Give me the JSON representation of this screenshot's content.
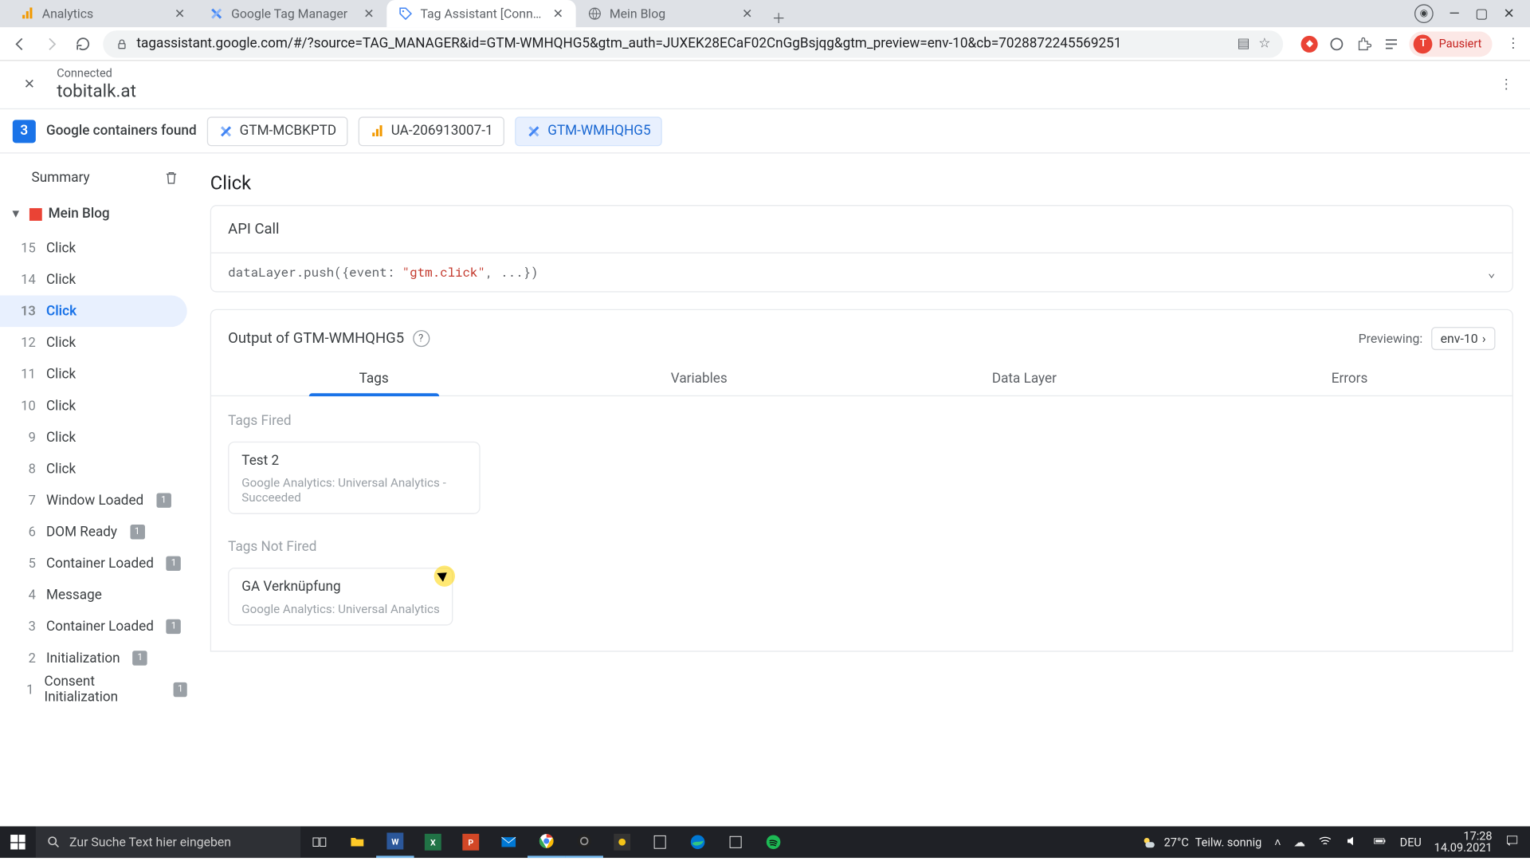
{
  "browser": {
    "tabs": [
      {
        "title": "Analytics",
        "icon_color": "#f29900"
      },
      {
        "title": "Google Tag Manager",
        "icon_color": "#4285f4"
      },
      {
        "title": "Tag Assistant [Connected]",
        "icon_color": "#4285f4",
        "active": true
      },
      {
        "title": "Mein Blog",
        "icon_color": "#5f6368"
      }
    ],
    "url": "tagassistant.google.com/#/?source=TAG_MANAGER&id=GTM-WMHQHG5&gtm_auth=JUXEK28ECaF02CnGgBsjqg&gtm_preview=env-10&cb=7028872245569251",
    "profile_label": "Pausiert",
    "profile_initial": "T"
  },
  "header": {
    "connected_label": "Connected",
    "domain": "tobitalk.at"
  },
  "containers": {
    "count": "3",
    "label": "Google containers found",
    "chips": [
      {
        "label": "GTM-MCBKPTD",
        "type": "gtm"
      },
      {
        "label": "UA-206913007-1",
        "type": "ua"
      },
      {
        "label": "GTM-WMHQHG5",
        "type": "gtm",
        "selected": true
      }
    ]
  },
  "sidebar": {
    "summary": "Summary",
    "blog_name": "Mein Blog",
    "events": [
      {
        "num": "15",
        "label": "Click"
      },
      {
        "num": "14",
        "label": "Click"
      },
      {
        "num": "13",
        "label": "Click",
        "active": true
      },
      {
        "num": "12",
        "label": "Click"
      },
      {
        "num": "11",
        "label": "Click"
      },
      {
        "num": "10",
        "label": "Click"
      },
      {
        "num": "9",
        "label": "Click"
      },
      {
        "num": "8",
        "label": "Click"
      },
      {
        "num": "7",
        "label": "Window Loaded",
        "badge": "1"
      },
      {
        "num": "6",
        "label": "DOM Ready",
        "badge": "1"
      },
      {
        "num": "5",
        "label": "Container Loaded",
        "badge": "1"
      },
      {
        "num": "4",
        "label": "Message"
      },
      {
        "num": "3",
        "label": "Container Loaded",
        "badge": "1"
      },
      {
        "num": "2",
        "label": "Initialization",
        "badge": "1"
      },
      {
        "num": "1",
        "label": "Consent Initialization",
        "badge": "1"
      }
    ]
  },
  "main": {
    "title": "Click",
    "api_call_label": "API Call",
    "api_call_code_pre": "dataLayer.push({event: ",
    "api_call_code_ev": "\"gtm.click\"",
    "api_call_code_post": ", ...})",
    "output_prefix": "Output of ",
    "output_id": "GTM-WMHQHG5",
    "previewing_label": "Previewing:",
    "env_label": "env-10",
    "tabs": {
      "tags": "Tags",
      "variables": "Variables",
      "datalayer": "Data Layer",
      "errors": "Errors"
    },
    "tags_fired_label": "Tags Fired",
    "tags_not_fired_label": "Tags Not Fired",
    "fired": [
      {
        "name": "Test 2",
        "desc": "Google Analytics: Universal Analytics - Succeeded"
      }
    ],
    "not_fired": [
      {
        "name": "GA Verknüpfung",
        "desc": "Google Analytics: Universal Analytics"
      }
    ]
  },
  "taskbar": {
    "search_placeholder": "Zur Suche Text hier eingeben",
    "weather_temp": "27°C",
    "weather_desc": "Teilw. sonnig",
    "lang": "DEU",
    "time": "17:28",
    "date": "14.09.2021"
  }
}
